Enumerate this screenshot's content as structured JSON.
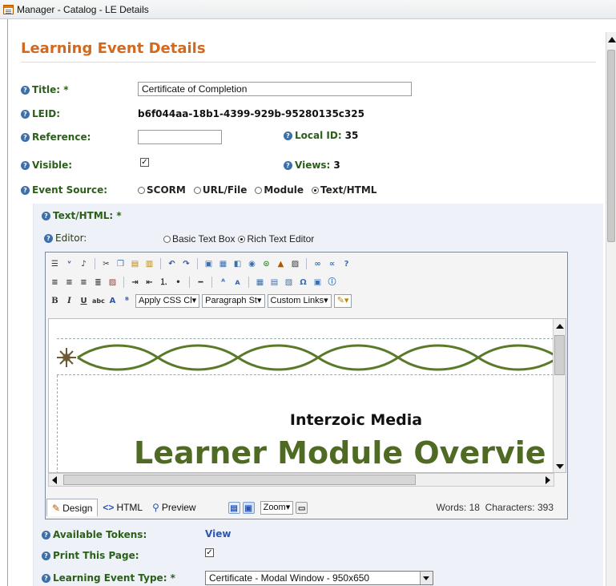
{
  "window": {
    "title": "Manager - Catalog - LE Details"
  },
  "page": {
    "title": "Learning Event Details"
  },
  "fields": {
    "title_label": "Title: *",
    "title_value": "Certificate of Completion",
    "leid_label": "LEID:",
    "leid_value": "b6f044aa-18b1-4399-929b-95280135c325",
    "reference_label": "Reference:",
    "reference_value": "",
    "local_id_label": "Local ID:",
    "local_id_value": "35",
    "visible_label": "Visible:",
    "visible_checked": true,
    "views_label": "Views:",
    "views_value": "3",
    "event_source_label": "Event Source:",
    "event_source_options": [
      "SCORM",
      "URL/File",
      "Module",
      "Text/HTML"
    ],
    "event_source_selected": "Text/HTML"
  },
  "texthtml": {
    "label": "Text/HTML: *",
    "editor_label": "Editor:",
    "editor_options": [
      "Basic Text Box",
      "Rich Text Editor"
    ],
    "editor_selected": "Rich Text Editor"
  },
  "toolbar": {
    "css_dropdown": "Apply CSS Cl",
    "paragraph_dropdown": "Paragraph St",
    "links_dropdown": "Custom Links"
  },
  "editor_content": {
    "org_name": "Interzoic Media",
    "heading": "Learner Module Overvie"
  },
  "statusbar": {
    "modes": [
      "Design",
      "HTML",
      "Preview"
    ],
    "active_mode": "Design",
    "zoom_label": "Zoom",
    "words_label": "Words: 18",
    "chars_label": "Characters: 393"
  },
  "bottom": {
    "tokens_label": "Available Tokens:",
    "tokens_link": "View",
    "print_label": "Print This Page:",
    "print_checked": true,
    "type_label": "Learning Event Type: *",
    "type_value": "Certificate - Modal Window - 950x650"
  },
  "colors": {
    "label_green": "#2a5f1a",
    "title_orange": "#d2691e",
    "panel_bg": "#eef1f8",
    "cert_green": "#4f6a23"
  }
}
